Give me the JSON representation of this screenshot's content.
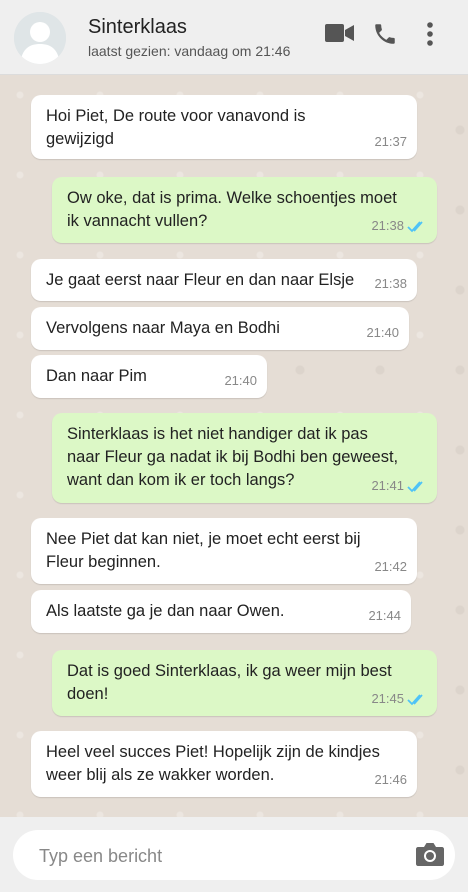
{
  "contact": {
    "name": "Sinterklaas",
    "last_seen": "laatst gezien: vandaag om 21:46"
  },
  "messages": [
    {
      "dir": "in",
      "text": "Hoi Piet, De route voor vanavond is\ngewijzigd",
      "time": "21:37"
    },
    {
      "dir": "out",
      "text": "Ow oke, dat is prima. Welke schoentjes moet\nik vannacht vullen?",
      "time": "21:38",
      "status": "read"
    },
    {
      "dir": "in",
      "text": "Je gaat eerst naar Fleur en dan naar Elsje",
      "time": "21:38"
    },
    {
      "dir": "in",
      "text": "Vervolgens naar Maya en Bodhi",
      "time": "21:40"
    },
    {
      "dir": "in",
      "text": "Dan naar Pim",
      "time": "21:40"
    },
    {
      "dir": "out",
      "text": "Sinterklaas is het niet handiger dat ik pas\nnaar Fleur ga nadat ik bij Bodhi ben geweest,\nwant dan kom ik er toch langs?",
      "time": "21:41",
      "status": "read"
    },
    {
      "dir": "in",
      "text": "Nee Piet dat kan niet, je moet echt eerst bij\nFleur beginnen.",
      "time": "21:42"
    },
    {
      "dir": "in",
      "text": "Als laatste ga je dan naar Owen.",
      "time": "21:44"
    },
    {
      "dir": "out",
      "text": "Dat is goed Sinterklaas, ik ga weer mijn best\ndoen!",
      "time": "21:45",
      "status": "read"
    },
    {
      "dir": "in",
      "text": "Heel veel succes Piet! Hopelijk zijn de kindjes\nweer blij als ze wakker worden.",
      "time": "21:46"
    }
  ],
  "composer": {
    "placeholder": "Typ een bericht"
  },
  "icons": {
    "header": [
      "video-call-icon",
      "phone-icon",
      "more-options-icon"
    ],
    "composer": [
      "camera-icon"
    ],
    "read_receipt": "double-check-icon"
  },
  "colors": {
    "incoming_bubble": "#ffffff",
    "outgoing_bubble": "#dcf8c6",
    "read_ticks": "#4fc3f7",
    "header_bg": "#efefef"
  }
}
